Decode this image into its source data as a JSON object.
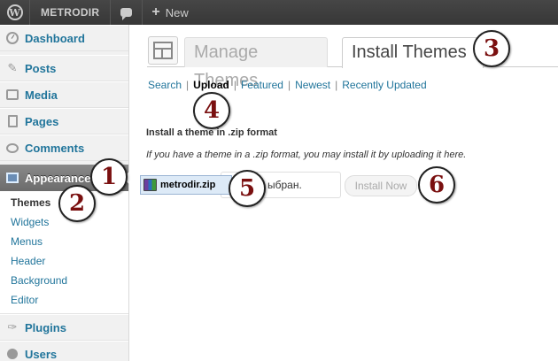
{
  "admin_bar": {
    "site_name": "METRODIR",
    "new_label": "New",
    "new_plus": "+",
    "wp_logo_glyph": "W"
  },
  "sidebar": {
    "items": [
      {
        "label": "Dashboard",
        "icon": "dashboard-icon"
      },
      {
        "label": "Posts",
        "icon": "pin-icon"
      },
      {
        "label": "Media",
        "icon": "media-icon"
      },
      {
        "label": "Pages",
        "icon": "pages-icon"
      },
      {
        "label": "Comments",
        "icon": "comment-icon"
      },
      {
        "label": "Appearance",
        "icon": "appearance-icon",
        "current": true
      },
      {
        "label": "Plugins",
        "icon": "plugin-icon"
      },
      {
        "label": "Users",
        "icon": "user-icon"
      }
    ],
    "appearance_submenu": [
      "Themes",
      "Widgets",
      "Menus",
      "Header",
      "Background",
      "Editor"
    ]
  },
  "main": {
    "tabs": [
      {
        "label": "Manage Themes",
        "active": false
      },
      {
        "label": "Install Themes",
        "active": true
      }
    ],
    "subnav": {
      "items": [
        "Search",
        "Upload",
        "Featured",
        "Newest",
        "Recently Updated"
      ],
      "current": "Upload",
      "separator": "|"
    },
    "heading": "Install a theme in .zip format",
    "description": "If you have a theme in a .zip format, you may install it by uploading it here.",
    "file_input_text": "ыбран.",
    "file_name": "metrodir.zip",
    "install_button": "Install Now"
  },
  "markers": [
    "1",
    "2",
    "3",
    "4",
    "5",
    "6"
  ],
  "colors": {
    "admin_bar": "#464646",
    "link": "#21759b",
    "current_menu": "#777777",
    "marker_number": "#7a1010"
  }
}
